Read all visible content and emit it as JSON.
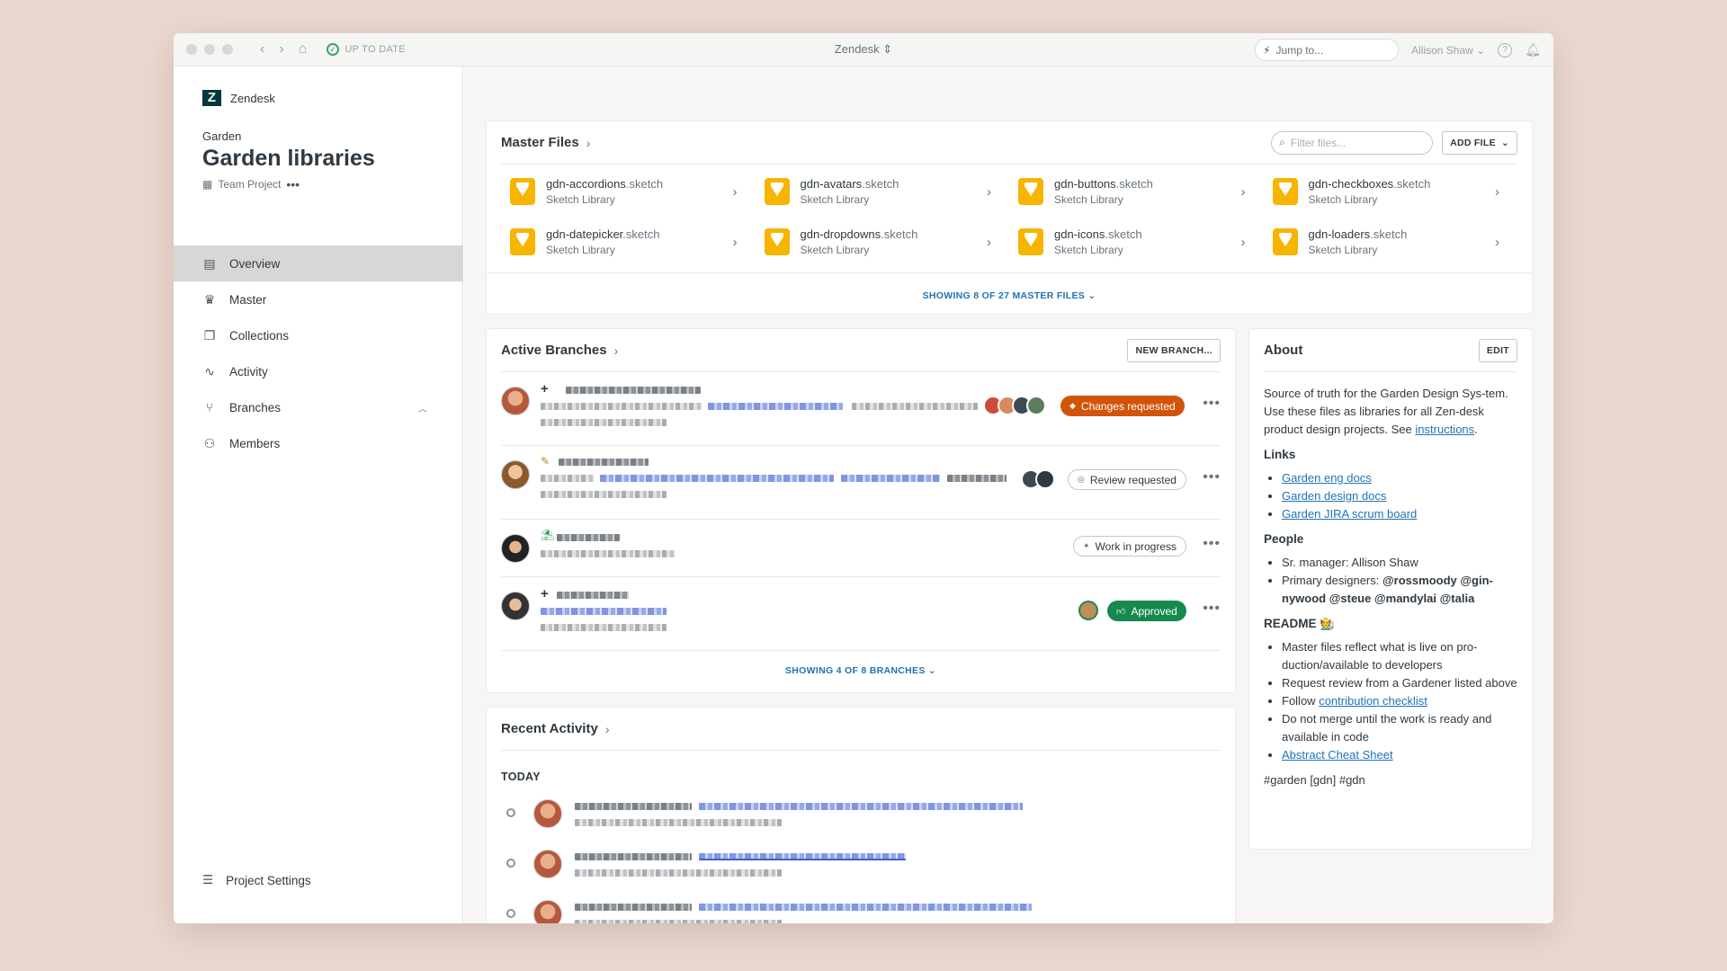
{
  "titlebar": {
    "status": "UP TO DATE",
    "app_title": "Zendesk",
    "jump_placeholder": "Jump to...",
    "user": "Allison Shaw"
  },
  "sidebar": {
    "org": "Zendesk",
    "parent": "Garden",
    "title": "Garden libraries",
    "subtitle": "Team Project",
    "items": [
      {
        "label": "Overview",
        "icon": "overview-icon"
      },
      {
        "label": "Master",
        "icon": "crown-icon"
      },
      {
        "label": "Collections",
        "icon": "collections-icon"
      },
      {
        "label": "Activity",
        "icon": "activity-icon"
      },
      {
        "label": "Branches",
        "icon": "branch-icon"
      },
      {
        "label": "Members",
        "icon": "person-icon"
      }
    ],
    "settings": "Project Settings"
  },
  "master_files": {
    "title": "Master Files",
    "filter_placeholder": "Filter files...",
    "add_file": "ADD FILE",
    "files": [
      {
        "name": "gdn-accordions",
        "ext": ".sketch",
        "type": "Sketch Library"
      },
      {
        "name": "gdn-avatars",
        "ext": ".sketch",
        "type": "Sketch Library"
      },
      {
        "name": "gdn-buttons",
        "ext": ".sketch",
        "type": "Sketch Library"
      },
      {
        "name": "gdn-checkboxes",
        "ext": ".sketch",
        "type": "Sketch Library"
      },
      {
        "name": "gdn-datepicker",
        "ext": ".sketch",
        "type": "Sketch Library"
      },
      {
        "name": "gdn-dropdowns",
        "ext": ".sketch",
        "type": "Sketch Library"
      },
      {
        "name": "gdn-icons",
        "ext": ".sketch",
        "type": "Sketch Library"
      },
      {
        "name": "gdn-loaders",
        "ext": ".sketch",
        "type": "Sketch Library"
      }
    ],
    "show_more": "SHOWING 8 OF 27 MASTER FILES"
  },
  "branches": {
    "title": "Active Branches",
    "new_branch": "NEW BRANCH...",
    "statuses": [
      "Changes requested",
      "Review requested",
      "Work in progress",
      "Approved"
    ],
    "show_more": "SHOWING 4 OF 8 BRANCHES"
  },
  "about": {
    "title": "About",
    "edit": "EDIT",
    "intro": "Source of truth for the Garden Design Sys-tem. Use these files as libraries for all Zen-desk product design projects. See",
    "intro_link": "instructions",
    "links_heading": "Links",
    "links": [
      "Garden eng docs",
      "Garden design docs",
      "Garden JIRA scrum board"
    ],
    "people_heading": "People",
    "people_manager": "Sr. manager: Allison Shaw",
    "people_designers_label": "Primary designers:",
    "people_designers": "@rossmoody @gin-nywood @steue @mandylai @talia",
    "readme_heading": "README 🧑‍🌾",
    "readme_1": "Master files reflect what is live on pro-duction/available to developers",
    "readme_2": "Request review from a Gardener listed above",
    "readme_3_pre": "Follow",
    "readme_3_link": "contribution checklist",
    "readme_4": "Do not merge until the work is ready and available in code",
    "readme_5_link": "Abstract Cheat Sheet",
    "tags": "#garden [gdn] #gdn"
  },
  "activity": {
    "title": "Recent Activity",
    "today": "TODAY"
  },
  "colors": {
    "accent_blue": "#1f73b7",
    "changes_orange": "#d2540a",
    "approved_green": "#168a4e",
    "sketch_yellow": "#f7b500"
  }
}
